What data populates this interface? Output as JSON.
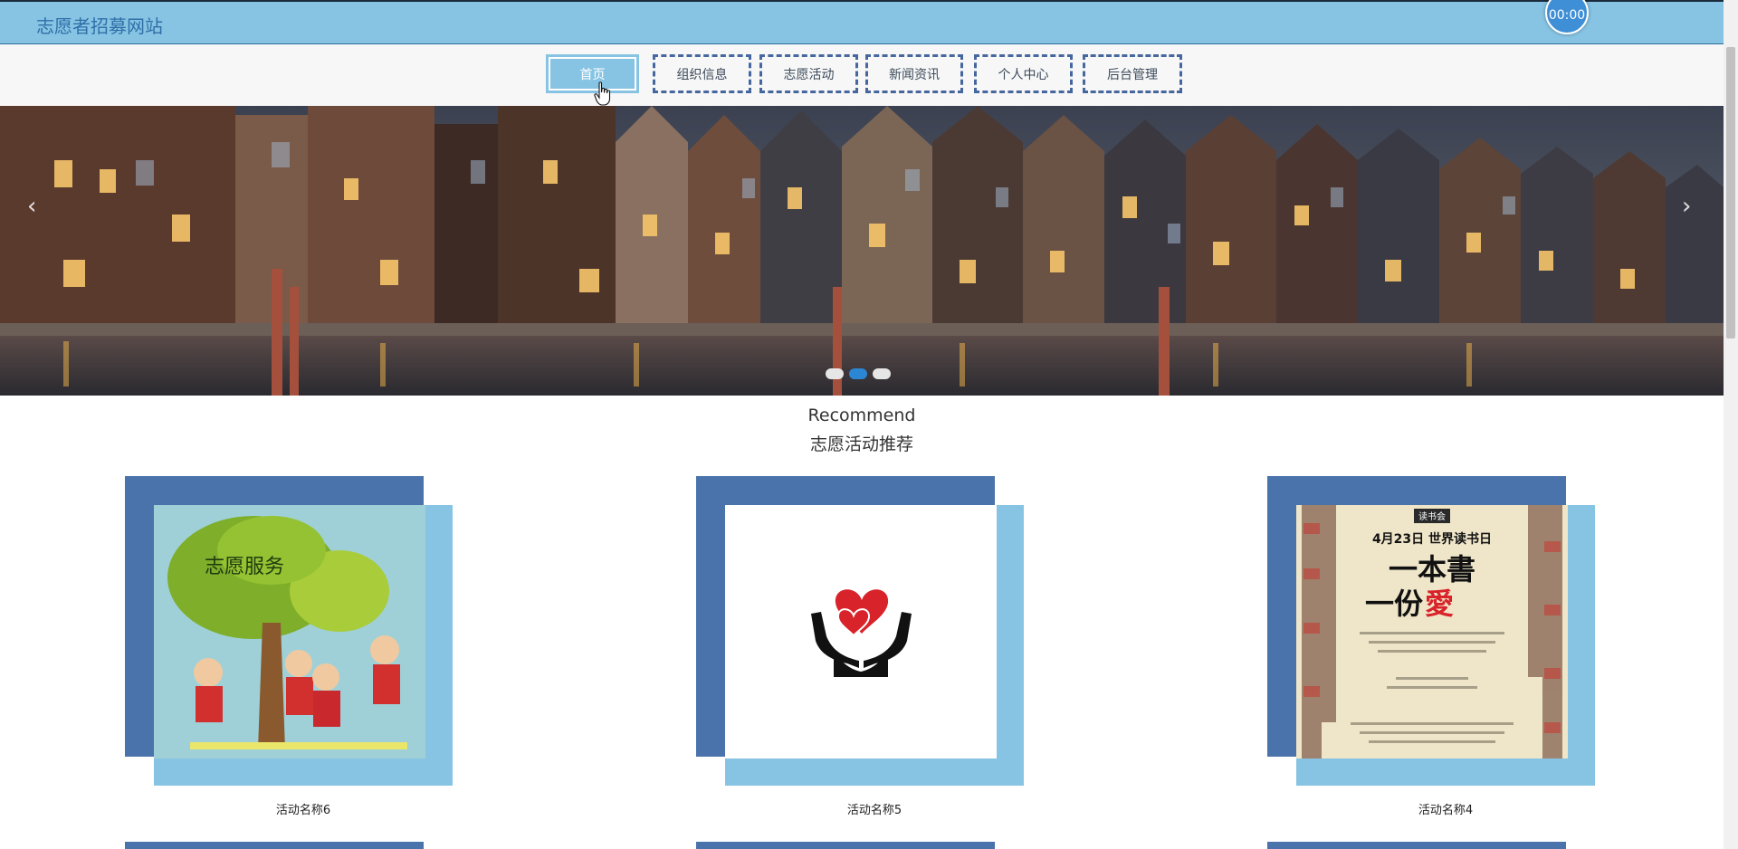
{
  "header": {
    "title": "志愿者招募网站",
    "timer": "00:00"
  },
  "nav": {
    "items": [
      {
        "label": "首页"
      },
      {
        "label": "组织信息"
      },
      {
        "label": "志愿活动"
      },
      {
        "label": "新闻资讯"
      },
      {
        "label": "个人中心"
      },
      {
        "label": "后台管理"
      }
    ]
  },
  "carousel": {
    "prev_icon": "‹",
    "next_icon": "›",
    "current_slide": 2,
    "slide_count": 3
  },
  "recommend": {
    "en_title": "Recommend",
    "cn_title": "志愿活动推荐",
    "cards": [
      {
        "name": "活动名称6",
        "img_label": "志愿服务"
      },
      {
        "name": "活动名称5"
      },
      {
        "name": "活动名称4",
        "poster": {
          "badge": "读书会",
          "date_line": "4月23日 世界读书日",
          "line1": "一本書",
          "line2_a": "一份",
          "line2_b": "愛"
        }
      }
    ]
  },
  "colors": {
    "topbar": "#87c4e4",
    "nav_border": "#46679e",
    "card_dark": "#4a72ab",
    "card_light": "#87c4e4",
    "dot_active": "#2b86d4"
  }
}
